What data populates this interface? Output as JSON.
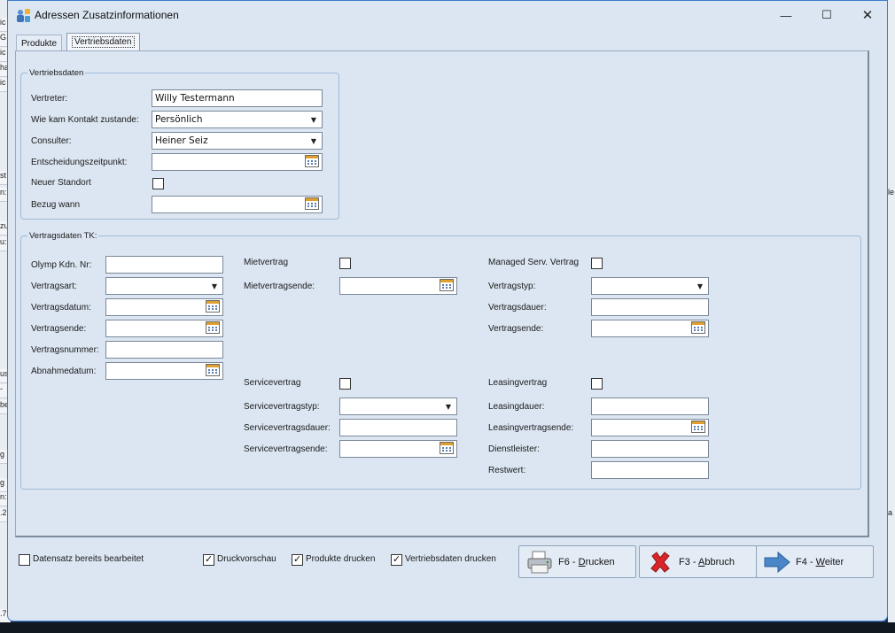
{
  "background": {
    "left_fragments": [
      "ic",
      "G",
      "ic",
      "ha",
      "ic",
      "st",
      "n:",
      "zu",
      "u:",
      "us",
      "-",
      "be",
      "g",
      "g",
      "n:",
      ".2",
      ".7"
    ],
    "right_fragments": [
      "le",
      "a"
    ]
  },
  "window": {
    "title": "Adressen Zusatzinformationen",
    "controls": {
      "minimize": "—",
      "maximize": "☐",
      "close": "✕"
    }
  },
  "tabs": [
    {
      "label": "Produkte",
      "active": false
    },
    {
      "label": "Vertriebsdaten",
      "active": true
    }
  ],
  "vertriebsdaten": {
    "title": "Vertriebsdaten",
    "vertreter_label": "Vertreter:",
    "vertreter_value": "Willy Testermann",
    "kontakt_label": "Wie kam Kontakt zustande:",
    "kontakt_value": "Persönlich",
    "consulter_label": "Consulter:",
    "consulter_value": "Heiner Seiz",
    "entscheidung_label": "Entscheidungszeitpunkt:",
    "entscheidung_value": "",
    "neuer_standort_label": "Neuer Standort",
    "neuer_standort_checked": false,
    "bezug_label": "Bezug wann",
    "bezug_value": ""
  },
  "vertragsdaten": {
    "title": "Vertragsdaten TK:",
    "olymp_label": "Olymp Kdn. Nr:",
    "olymp_value": "",
    "vertragsart_label": "Vertragsart:",
    "vertragsart_value": "",
    "vertragsdatum_label": "Vertragsdatum:",
    "vertragsdatum_value": "",
    "vertragsende_label": "Vertragsende:",
    "vertragsende_value": "",
    "vertragsnummer_label": "Vertragsnummer:",
    "vertragsnummer_value": "",
    "abnahmedatum_label": "Abnahmedatum:",
    "abnahmedatum_value": "",
    "mietvertrag_label": "Mietvertrag",
    "mietvertrag_checked": false,
    "mietvertragsende_label": "Mietvertragsende:",
    "mietvertragsende_value": "",
    "servicevertrag_label": "Servicevertrag",
    "servicevertrag_checked": false,
    "servicevertragstyp_label": "Servicevertragstyp:",
    "servicevertragstyp_value": "",
    "servicevertragsdauer_label": "Servicevertragsdauer:",
    "servicevertragsdauer_value": "",
    "servicevertragsende_label": "Servicevertragsende:",
    "servicevertragsende_value": "",
    "managed_label": "Managed Serv. Vertrag",
    "managed_checked": false,
    "vertragstyp_label": "Vertragstyp:",
    "vertragstyp_value": "",
    "vertragsdauer_label": "Vertragsdauer:",
    "vertragsdauer_value": "",
    "ms_vertragsende_label": "Vertragsende:",
    "ms_vertragsende_value": "",
    "leasingvertrag_label": "Leasingvertrag",
    "leasingvertrag_checked": false,
    "leasingdauer_label": "Leasingdauer:",
    "leasingdauer_value": "",
    "leasingvertragsende_label": "Leasingvertragsende:",
    "leasingvertragsende_value": "",
    "dienstleister_label": "Dienstleister:",
    "dienstleister_value": "",
    "restwert_label": "Restwert:",
    "restwert_value": ""
  },
  "footer": {
    "bearbeitet_label": "Datensatz bereits bearbeitet",
    "bearbeitet_checked": false,
    "druckvorschau_label": "Druckvorschau",
    "druckvorschau_checked": true,
    "produkte_drucken_label": "Produkte drucken",
    "produkte_drucken_checked": true,
    "vertriebsdaten_drucken_label": "Vertriebsdaten drucken",
    "vertriebsdaten_drucken_checked": true
  },
  "buttons": {
    "drucken_prefix": "F6 - ",
    "drucken_key": "D",
    "drucken_rest": "rucken",
    "drucken_icon": "printer-icon",
    "abbruch_prefix": "F3 - ",
    "abbruch_key": "A",
    "abbruch_rest": "bbruch",
    "abbruch_icon": "red-x-icon",
    "weiter_prefix": "F4 - ",
    "weiter_key": "W",
    "weiter_rest": "eiter",
    "weiter_icon": "blue-arrow-right-icon"
  },
  "colors": {
    "window_bg": "#dbe6f2",
    "window_border": "#3d7ccf",
    "cancel_red": "#d9262a",
    "arrow_blue": "#4a86c8"
  }
}
